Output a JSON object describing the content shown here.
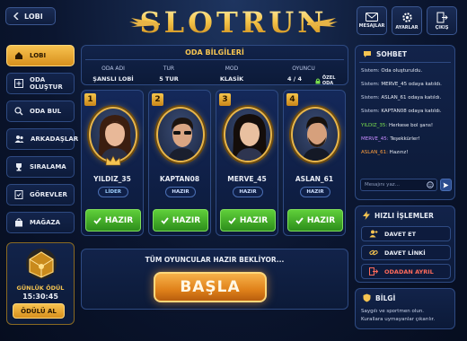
{
  "topbar": {
    "back_label": "LOBI",
    "logo": "SLOTRUN",
    "icons": [
      {
        "name": "messages",
        "label": "MESAJLAR"
      },
      {
        "name": "settings",
        "label": "AYARLAR"
      },
      {
        "name": "exit",
        "label": "ÇIKIŞ"
      }
    ]
  },
  "sidebar": {
    "items": [
      {
        "label": "LOBI",
        "icon": "home-icon",
        "active": true
      },
      {
        "label": "ODA OLUŞTUR",
        "icon": "plus-square-icon"
      },
      {
        "label": "ODA BUL",
        "icon": "search-icon"
      },
      {
        "label": "ARKADAŞLAR",
        "icon": "friends-icon"
      },
      {
        "label": "SIRALAMA",
        "icon": "trophy-icon"
      },
      {
        "label": "GÖREVLER",
        "icon": "checklist-icon"
      },
      {
        "label": "MAĞAZA",
        "icon": "shop-bag-icon"
      }
    ],
    "reward": {
      "title": "GÜNLÜK ÖDÜL",
      "time": "15:30:45",
      "button": "ÖDÜLÜ AL"
    }
  },
  "room": {
    "title": "ODA BİLGİLERİ",
    "headers": [
      "ODA ADI",
      "TUR",
      "MOD",
      "OYUNCU"
    ],
    "values": [
      "ŞANSLI LOBİ",
      "5 TUR",
      "KLASİK",
      "4 / 4"
    ],
    "private_label": "ÖZEL ODA"
  },
  "players": [
    {
      "num": "1",
      "name": "YILDIZ_35",
      "badge": "LİDER",
      "ready": "HAZIR",
      "leader": true
    },
    {
      "num": "2",
      "name": "KAPTAN08",
      "badge": "HAZIR",
      "ready": "HAZIR"
    },
    {
      "num": "3",
      "name": "MERVE_45",
      "badge": "HAZIR",
      "ready": "HAZIR"
    },
    {
      "num": "4",
      "name": "ASLAN_61",
      "badge": "HAZIR",
      "ready": "HAZIR"
    }
  ],
  "waiting": {
    "text": "TÜM OYUNCULAR HAZIR BEKLİYOR...",
    "start": "BAŞLA"
  },
  "chat": {
    "title": "SOHBET",
    "messages": [
      {
        "who": "Sistem:",
        "text": " Oda oluşturuldu.",
        "color": "#c9d3ea"
      },
      {
        "who": "Sistem:",
        "text": " MERVE_45 odaya katıldı.",
        "color": "#c9d3ea"
      },
      {
        "who": "Sistem:",
        "text": " ASLAN_61 odaya katıldı.",
        "color": "#c9d3ea"
      },
      {
        "who": "Sistem:",
        "text": " KAPTAN08 odaya katıldı.",
        "color": "#c9d3ea"
      },
      {
        "who": "YILDIZ_35:",
        "text": " Herkese bol şans!",
        "color": "#7be04e"
      },
      {
        "who": "MERVE_45:",
        "text": " Teşekkürler!",
        "color": "#c58bff"
      },
      {
        "who": "ASLAN_61:",
        "text": " Hazırız!",
        "color": "#ff9d3c"
      }
    ],
    "placeholder": "Mesajını yaz..."
  },
  "quick": {
    "title": "HIZLI İŞLEMLER",
    "items": [
      {
        "label": "DAVET ET",
        "icon": "user-plus-icon"
      },
      {
        "label": "DAVET LİNKİ",
        "icon": "link-icon"
      },
      {
        "label": "ODADAN AYRIL",
        "icon": "leave-icon"
      }
    ]
  },
  "info": {
    "title": "BİLGİ",
    "line1": "Saygılı ve sportmen olun.",
    "line2": "Kurallara uymayanlar çıkarılır."
  }
}
